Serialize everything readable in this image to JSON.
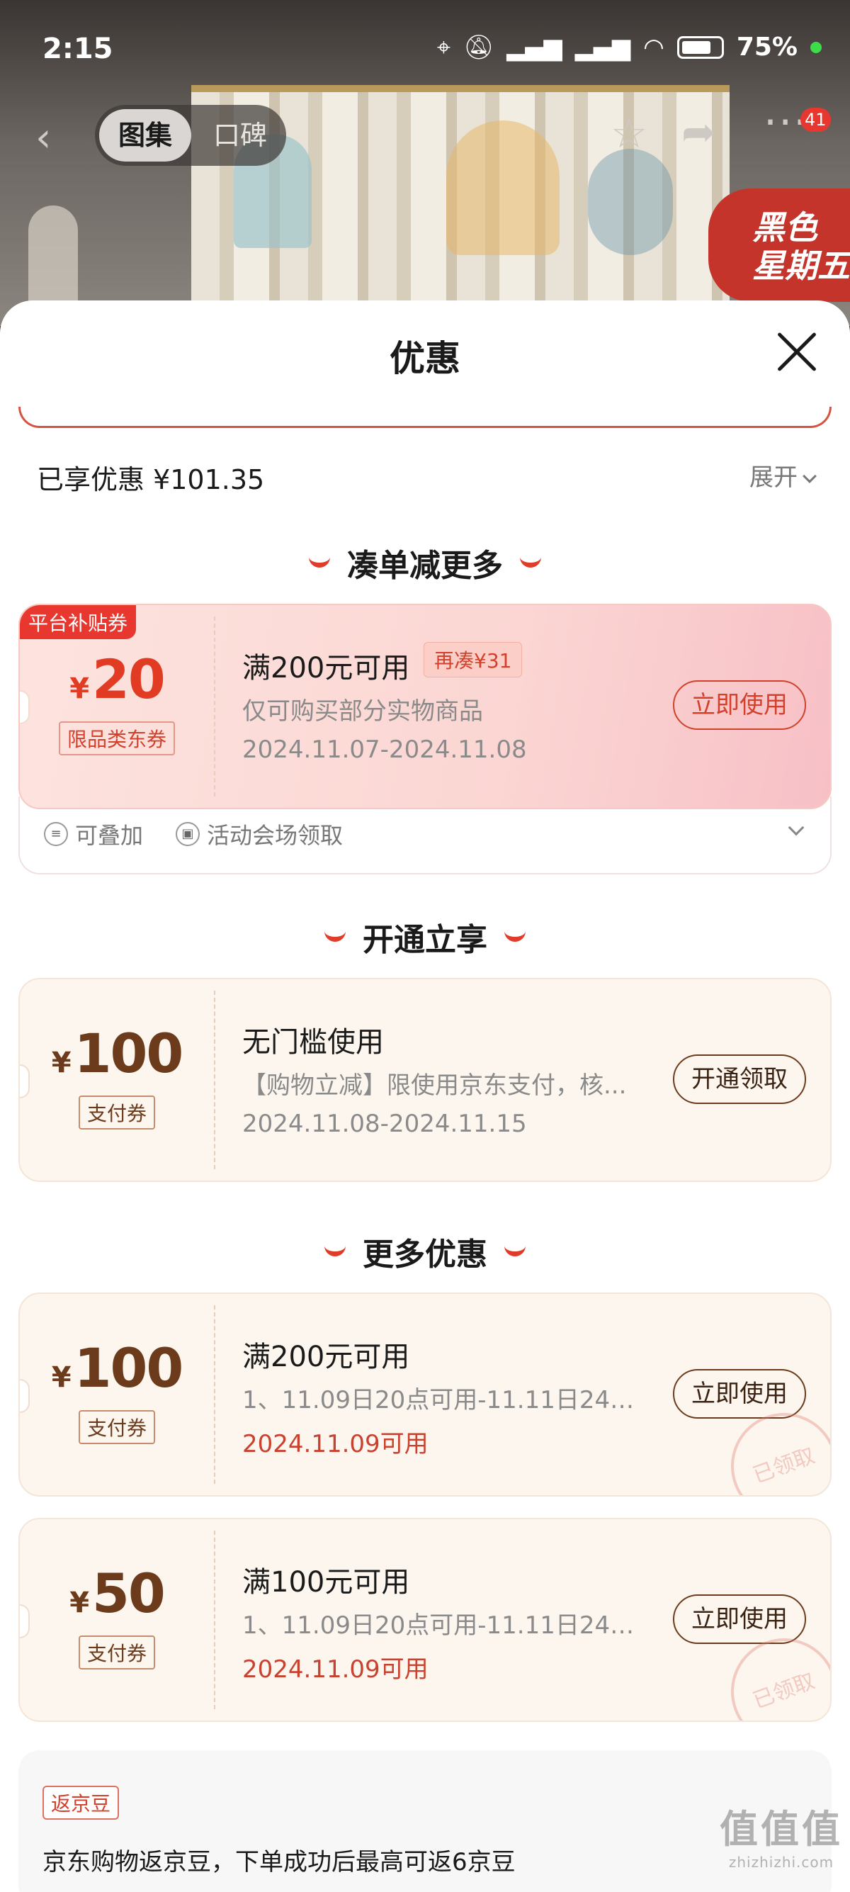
{
  "status_bar": {
    "time": "2:15",
    "battery": "75%"
  },
  "nav": {
    "tab_active": "图集",
    "tab_inactive": "口碑",
    "badge": "41"
  },
  "promo_flag": {
    "line1": "黑色",
    "line2": "星期五"
  },
  "sheet": {
    "title": "优惠",
    "enjoyed_label": "已享优惠 ¥101.35",
    "expand_label": "展开"
  },
  "sections": [
    {
      "title": "凑单减更多"
    },
    {
      "title": "开通立享"
    },
    {
      "title": "更多优惠"
    }
  ],
  "coupons": [
    {
      "corner_tag": "平台补贴券",
      "yen": "¥",
      "amount": "20",
      "type_tag": "限品类东券",
      "title": "满200元可用",
      "extra_tag": "再凑¥31",
      "subtitle": "仅可购买部分实物商品",
      "date": "2024.11.07-2024.11.08",
      "button": "立即使用"
    },
    {
      "yen": "¥",
      "amount": "100",
      "type_tag": "支付券",
      "title": "无门槛使用",
      "subtitle": "【购物立减】限使用京东支付，核...",
      "date": "2024.11.08-2024.11.15",
      "button": "开通领取"
    },
    {
      "yen": "¥",
      "amount": "100",
      "type_tag": "支付券",
      "title": "满200元可用",
      "subtitle": "1、11.09日20点可用-11.11日24点...",
      "date": "2024.11.09可用",
      "button": "立即使用",
      "stamp": "已领取"
    },
    {
      "yen": "¥",
      "amount": "50",
      "type_tag": "支付券",
      "title": "满100元可用",
      "subtitle": "1、11.09日20点可用-11.11日24点...",
      "date": "2024.11.09可用",
      "button": "立即使用",
      "stamp": "已领取"
    }
  ],
  "coupon_footer": {
    "stackable": "可叠加",
    "source": "活动会场领取"
  },
  "jd_beans": {
    "tag": "返京豆",
    "text": "京东购物返京豆，下单成功后最高可返6京豆"
  },
  "watermark": {
    "main": "值值值",
    "sub": "zhizhizhi.com"
  },
  "colors": {
    "accent_red": "#e23b24",
    "brown": "#6b3b1c",
    "sheet_bg": "#ffffff"
  },
  "icons": {
    "back": "chevron-left-icon",
    "star": "star-icon",
    "share": "share-icon",
    "more": "more-icon",
    "close": "close-icon"
  }
}
